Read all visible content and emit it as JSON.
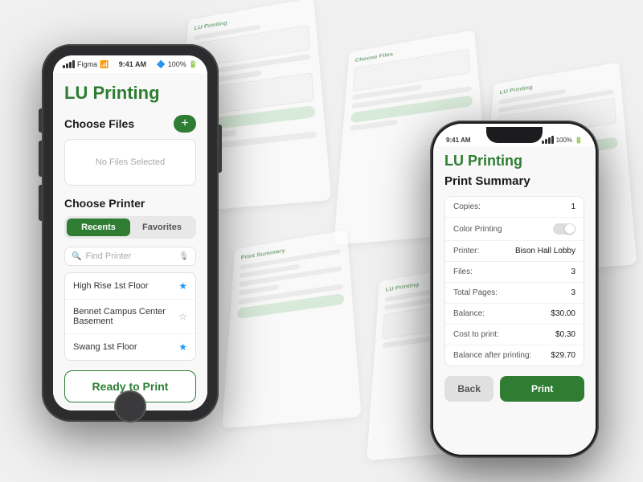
{
  "background": {
    "color": "#f0f0f0"
  },
  "phone1": {
    "status_bar": {
      "carrier": "Figma",
      "time": "9:41 AM",
      "battery": "100%"
    },
    "app": {
      "title": "LU Printing",
      "choose_files": {
        "label": "Choose Files",
        "add_btn": "+",
        "no_files_text": "No Files Selected"
      },
      "choose_printer": {
        "label": "Choose Printer",
        "tabs": [
          "Recents",
          "Favorites"
        ],
        "active_tab": 0,
        "search_placeholder": "Find Printer",
        "printers": [
          {
            "name": "High Rise 1st Floor",
            "starred": true
          },
          {
            "name": "Bennet Campus Center Basement",
            "starred": false
          },
          {
            "name": "Swang 1st Floor",
            "starred": true
          }
        ]
      },
      "ready_print_btn": "Ready to Print"
    }
  },
  "phone2": {
    "status_bar": {
      "time": "9:41 AM",
      "battery": "100%"
    },
    "app": {
      "title": "LU Printing",
      "print_summary": {
        "label": "Print Summary",
        "rows": [
          {
            "label": "Copies:",
            "value": "1",
            "type": "text"
          },
          {
            "label": "Color Printing",
            "value": "",
            "type": "toggle"
          },
          {
            "label": "Printer:",
            "value": "Bison Hall Lobby",
            "type": "text"
          },
          {
            "label": "Files:",
            "value": "3",
            "type": "text"
          },
          {
            "label": "Total Pages:",
            "value": "3",
            "type": "text"
          },
          {
            "label": "Balance:",
            "value": "$30.00",
            "type": "text"
          },
          {
            "label": "Cost to print:",
            "value": "$0.30",
            "type": "text"
          },
          {
            "label": "Balance after printing:",
            "value": "$29.70",
            "type": "text"
          }
        ]
      },
      "back_btn": "Back",
      "print_btn": "Print"
    }
  }
}
